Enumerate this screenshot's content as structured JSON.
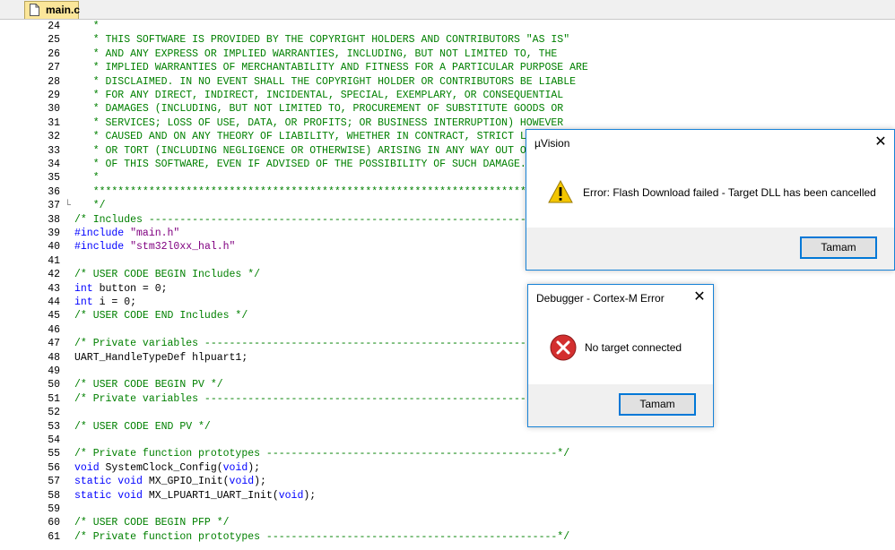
{
  "tab": {
    "label": "main.c"
  },
  "lines": [
    {
      "n": "24",
      "fold": "",
      "parts": [
        {
          "c": "cmt",
          "t": "   *"
        }
      ]
    },
    {
      "n": "25",
      "fold": "",
      "parts": [
        {
          "c": "cmt",
          "t": "   * THIS SOFTWARE IS PROVIDED BY THE COPYRIGHT HOLDERS AND CONTRIBUTORS \"AS IS\""
        }
      ]
    },
    {
      "n": "26",
      "fold": "",
      "parts": [
        {
          "c": "cmt",
          "t": "   * AND ANY EXPRESS OR IMPLIED WARRANTIES, INCLUDING, BUT NOT LIMITED TO, THE"
        }
      ]
    },
    {
      "n": "27",
      "fold": "",
      "parts": [
        {
          "c": "cmt",
          "t": "   * IMPLIED WARRANTIES OF MERCHANTABILITY AND FITNESS FOR A PARTICULAR PURPOSE ARE"
        }
      ]
    },
    {
      "n": "28",
      "fold": "",
      "parts": [
        {
          "c": "cmt",
          "t": "   * DISCLAIMED. IN NO EVENT SHALL THE COPYRIGHT HOLDER OR CONTRIBUTORS BE LIABLE"
        }
      ]
    },
    {
      "n": "29",
      "fold": "",
      "parts": [
        {
          "c": "cmt",
          "t": "   * FOR ANY DIRECT, INDIRECT, INCIDENTAL, SPECIAL, EXEMPLARY, OR CONSEQUENTIAL"
        }
      ]
    },
    {
      "n": "30",
      "fold": "",
      "parts": [
        {
          "c": "cmt",
          "t": "   * DAMAGES (INCLUDING, BUT NOT LIMITED TO, PROCUREMENT OF SUBSTITUTE GOODS OR"
        }
      ]
    },
    {
      "n": "31",
      "fold": "",
      "parts": [
        {
          "c": "cmt",
          "t": "   * SERVICES; LOSS OF USE, DATA, OR PROFITS; OR BUSINESS INTERRUPTION) HOWEVER"
        }
      ]
    },
    {
      "n": "32",
      "fold": "",
      "parts": [
        {
          "c": "cmt",
          "t": "   * CAUSED AND ON ANY THEORY OF LIABILITY, WHETHER IN CONTRACT, STRICT LIABILITY,"
        }
      ]
    },
    {
      "n": "33",
      "fold": "",
      "parts": [
        {
          "c": "cmt",
          "t": "   * OR TORT (INCLUDING NEGLIGENCE OR OTHERWISE) ARISING IN ANY WAY OUT OF THE USE"
        }
      ]
    },
    {
      "n": "34",
      "fold": "",
      "parts": [
        {
          "c": "cmt",
          "t": "   * OF THIS SOFTWARE, EVEN IF ADVISED OF THE POSSIBILITY OF SUCH DAMAGE."
        }
      ]
    },
    {
      "n": "35",
      "fold": "",
      "parts": [
        {
          "c": "cmt",
          "t": "   *"
        }
      ]
    },
    {
      "n": "36",
      "fold": "",
      "parts": [
        {
          "c": "cmt",
          "t": "   ******************************************************************************"
        }
      ]
    },
    {
      "n": "37",
      "fold": "└",
      "parts": [
        {
          "c": "cmt",
          "t": "   */"
        }
      ]
    },
    {
      "n": "38",
      "fold": "",
      "parts": [
        {
          "c": "cmt",
          "t": "/* Includes ------------------------------------------------------------------*/"
        }
      ]
    },
    {
      "n": "39",
      "fold": "",
      "parts": [
        {
          "c": "kw",
          "t": "#include "
        },
        {
          "c": "str",
          "t": "\"main.h\""
        }
      ]
    },
    {
      "n": "40",
      "fold": "",
      "parts": [
        {
          "c": "kw",
          "t": "#include "
        },
        {
          "c": "str",
          "t": "\"stm32l0xx_hal.h\""
        }
      ]
    },
    {
      "n": "41",
      "fold": "",
      "parts": [
        {
          "c": "plain",
          "t": ""
        }
      ]
    },
    {
      "n": "42",
      "fold": "",
      "parts": [
        {
          "c": "cmt",
          "t": "/* USER CODE BEGIN Includes */"
        }
      ]
    },
    {
      "n": "43",
      "fold": "",
      "parts": [
        {
          "c": "kw",
          "t": "int"
        },
        {
          "c": "plain",
          "t": " button = 0;"
        }
      ]
    },
    {
      "n": "44",
      "fold": "",
      "parts": [
        {
          "c": "kw",
          "t": "int"
        },
        {
          "c": "plain",
          "t": " i = 0;"
        }
      ]
    },
    {
      "n": "45",
      "fold": "",
      "parts": [
        {
          "c": "cmt",
          "t": "/* USER CODE END Includes */"
        }
      ]
    },
    {
      "n": "46",
      "fold": "",
      "parts": [
        {
          "c": "plain",
          "t": ""
        }
      ]
    },
    {
      "n": "47",
      "fold": "",
      "parts": [
        {
          "c": "cmt",
          "t": "/* Private variables ---------------------------------------------------------*/"
        }
      ]
    },
    {
      "n": "48",
      "fold": "",
      "parts": [
        {
          "c": "plain",
          "t": "UART_HandleTypeDef hlpuart1;"
        }
      ]
    },
    {
      "n": "49",
      "fold": "",
      "parts": [
        {
          "c": "plain",
          "t": ""
        }
      ]
    },
    {
      "n": "50",
      "fold": "",
      "parts": [
        {
          "c": "cmt",
          "t": "/* USER CODE BEGIN PV */"
        }
      ]
    },
    {
      "n": "51",
      "fold": "",
      "parts": [
        {
          "c": "cmt",
          "t": "/* Private variables ---------------------------------------------------------*/"
        }
      ]
    },
    {
      "n": "52",
      "fold": "",
      "parts": [
        {
          "c": "plain",
          "t": ""
        }
      ]
    },
    {
      "n": "53",
      "fold": "",
      "parts": [
        {
          "c": "cmt",
          "t": "/* USER CODE END PV */"
        }
      ]
    },
    {
      "n": "54",
      "fold": "",
      "parts": [
        {
          "c": "plain",
          "t": ""
        }
      ]
    },
    {
      "n": "55",
      "fold": "",
      "parts": [
        {
          "c": "cmt",
          "t": "/* Private function prototypes -----------------------------------------------*/"
        }
      ]
    },
    {
      "n": "56",
      "fold": "",
      "parts": [
        {
          "c": "kw",
          "t": "void"
        },
        {
          "c": "plain",
          "t": " SystemClock_Config("
        },
        {
          "c": "kw",
          "t": "void"
        },
        {
          "c": "plain",
          "t": ");"
        }
      ]
    },
    {
      "n": "57",
      "fold": "",
      "parts": [
        {
          "c": "kw",
          "t": "static void"
        },
        {
          "c": "plain",
          "t": " MX_GPIO_Init("
        },
        {
          "c": "kw",
          "t": "void"
        },
        {
          "c": "plain",
          "t": ");"
        }
      ]
    },
    {
      "n": "58",
      "fold": "",
      "parts": [
        {
          "c": "kw",
          "t": "static void"
        },
        {
          "c": "plain",
          "t": " MX_LPUART1_UART_Init("
        },
        {
          "c": "kw",
          "t": "void"
        },
        {
          "c": "plain",
          "t": ");"
        }
      ]
    },
    {
      "n": "59",
      "fold": "",
      "parts": [
        {
          "c": "plain",
          "t": ""
        }
      ]
    },
    {
      "n": "60",
      "fold": "",
      "parts": [
        {
          "c": "cmt",
          "t": "/* USER CODE BEGIN PFP */"
        }
      ]
    },
    {
      "n": "61",
      "fold": "",
      "parts": [
        {
          "c": "cmt",
          "t": "/* Private function prototypes -----------------------------------------------*/"
        }
      ]
    }
  ],
  "dialog_uvision": {
    "title": "µVision",
    "message": "Error: Flash Download failed  -  Target DLL has been cancelled",
    "button": "Tamam",
    "icon": "warning-icon"
  },
  "dialog_debugger": {
    "title": "Debugger - Cortex-M Error",
    "message": "No target connected",
    "button": "Tamam",
    "icon": "error-icon"
  },
  "colors": {
    "comment": "#008000",
    "keyword": "#0000ff",
    "string": "#800080",
    "accent": "#1883d7"
  }
}
